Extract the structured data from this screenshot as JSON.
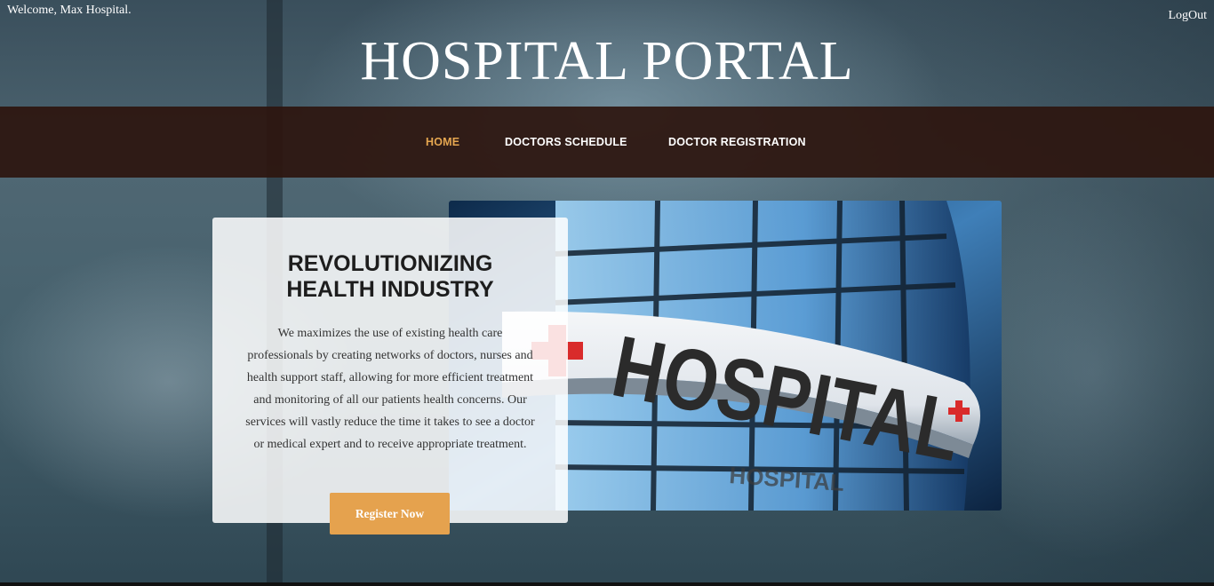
{
  "header": {
    "welcome_text": "Welcome, Max Hospital.",
    "logout_label": "LogOut",
    "site_title": "HOSPITAL PORTAL"
  },
  "nav": {
    "items": [
      {
        "label": "HOME",
        "active": true
      },
      {
        "label": "DOCTORS SCHEDULE",
        "active": false
      },
      {
        "label": "DOCTOR REGISTRATION",
        "active": false
      }
    ]
  },
  "hero": {
    "heading_line1": "REVOLUTIONIZING",
    "heading_line2": "HEALTH INDUSTRY",
    "description": "We maximizes the use of existing health care professionals by creating networks of doctors, nurses and health support staff, allowing for more efficient treatment and monitoring of all our patients health concerns. Our services will vastly reduce the time it takes to see a doctor or medical expert and to receive appropriate treatment.",
    "register_label": "Register Now",
    "image_sign_text": "HOSPITAL",
    "image_reflection_text": "HOSPITAL"
  },
  "colors": {
    "accent": "#e5a650",
    "navbar_bg": "#2d160f",
    "button_bg": "#e5a24e",
    "cross_red": "#d92b2b"
  }
}
